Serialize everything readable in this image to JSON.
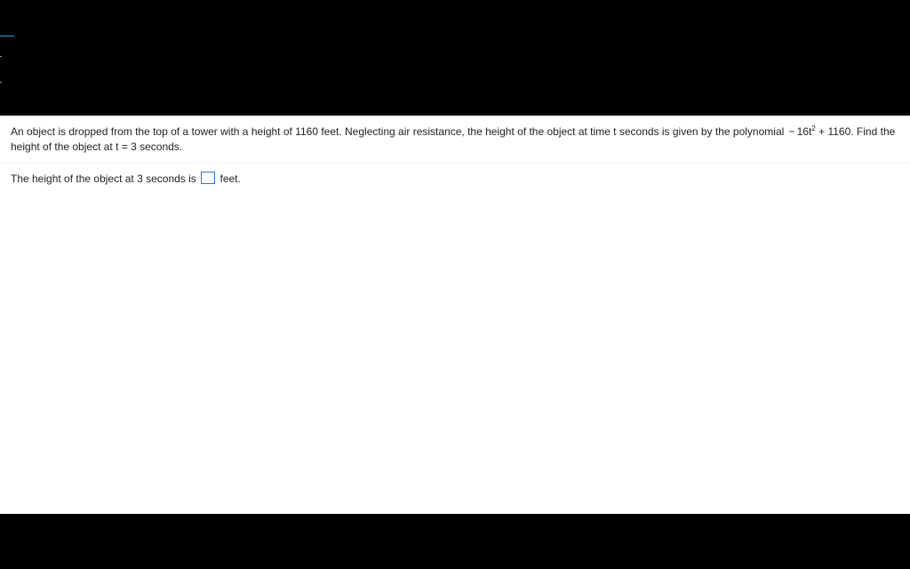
{
  "question": {
    "prefix": "An object is dropped from the top of a tower with a height of 1160 feet. Neglecting air resistance, the height of the object at time t seconds is given by the polynomial ",
    "neg": "−",
    "coeff": "16t",
    "exp": "2",
    "plus": " + 1160. Find the height of the object at t = 3 seconds."
  },
  "answer": {
    "prefix": "The height of the object at 3 seconds is ",
    "value": "",
    "suffix": " feet."
  }
}
